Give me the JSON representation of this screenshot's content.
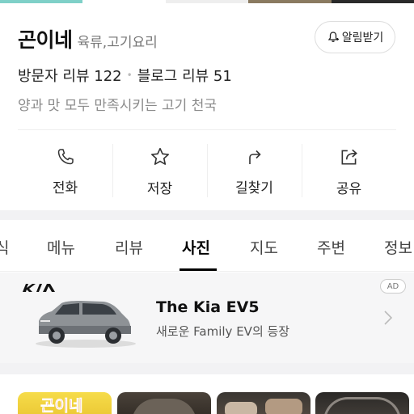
{
  "place": {
    "name": "곤이네",
    "category": "육류,고기요리",
    "visitor_reviews": "방문자 리뷰 122",
    "blog_reviews": "블로그 리뷰 51",
    "tagline": "양과 맛 모두 만족시키는 고기 천국"
  },
  "alert_button": {
    "label": "알림받기",
    "icon": "bell-plus-icon"
  },
  "actions": [
    {
      "label": "전화",
      "icon": "phone-icon"
    },
    {
      "label": "저장",
      "icon": "star-icon"
    },
    {
      "label": "길찾기",
      "icon": "directions-icon"
    },
    {
      "label": "공유",
      "icon": "share-icon"
    }
  ],
  "tabs": {
    "items": [
      "식",
      "메뉴",
      "리뷰",
      "사진",
      "지도",
      "주변",
      "정보"
    ],
    "active": "사진"
  },
  "ad": {
    "badge": "AD",
    "brand_logo": "kia-logo",
    "title": "The Kia EV5",
    "subtitle": "새로운 Family EV의 등장",
    "chevron_icon": "chevron-right-icon"
  },
  "photos": {
    "first_thumb_text": "곤이네"
  },
  "colors": {
    "tab_active": "#000000",
    "separator": "#f2f2f4",
    "ad_background": "#f6f6f7",
    "muted_text": "#8a8a8a"
  }
}
